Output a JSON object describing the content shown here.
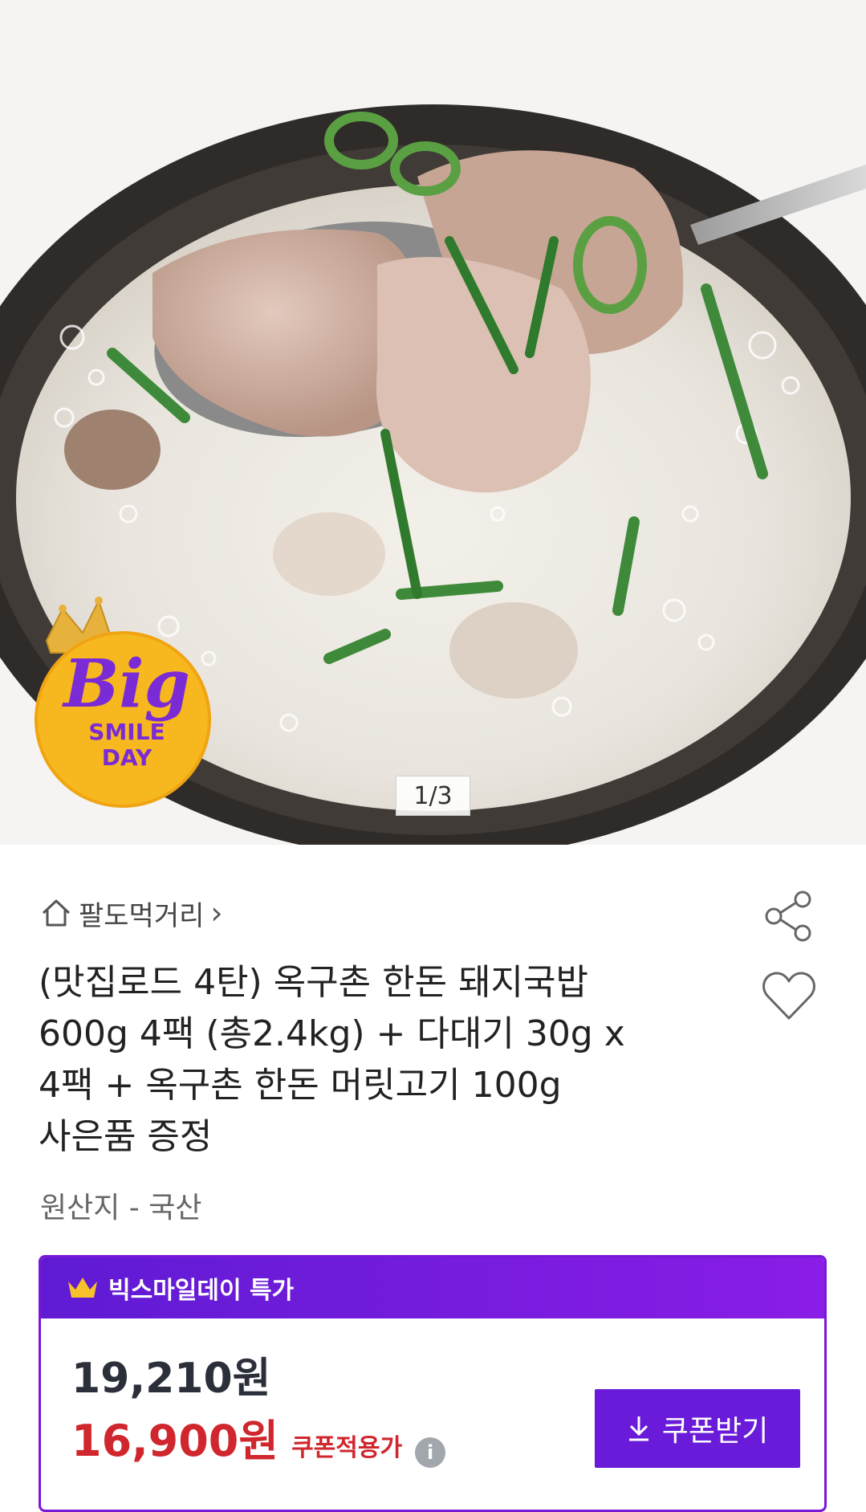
{
  "hero": {
    "page_indicator": "1/3",
    "badge": {
      "line1": "Big",
      "line2": "SMILE",
      "line3": "DAY"
    }
  },
  "store": {
    "name": "팔도먹거리",
    "chevron": "›",
    "icon": "home-icon"
  },
  "actions": {
    "share_icon": "share-icon",
    "wish_icon": "heart-icon"
  },
  "product": {
    "title_lines": [
      "(맛집로드 4탄) 옥구촌 한돈 돼지국밥",
      "600g 4팩 (총2.4kg) + 다대기 30g x",
      "4팩 + 옥구촌 한돈 머릿고기 100g",
      "사은품 증정"
    ],
    "origin": "원산지 - 국산"
  },
  "deal": {
    "header": "빅스마일데이 특가",
    "header_icon": "crown-icon",
    "original_price": "19,210원",
    "sale_price": "16,900원",
    "coupon_label": "쿠폰적용가",
    "info_icon": "i",
    "coupon_button": "쿠폰받기",
    "colors": {
      "accent": "#6a1bda",
      "sale": "#d0262d"
    }
  }
}
